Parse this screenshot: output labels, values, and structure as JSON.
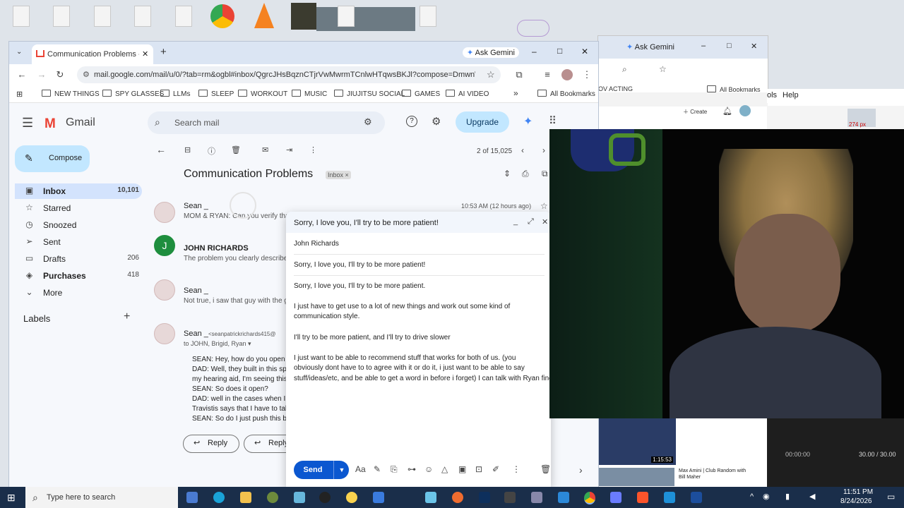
{
  "browser": {
    "tab_title": "Communication Problems - sea",
    "new_tab": "+",
    "ask_gemini": "Ask Gemini",
    "url": "mail.google.com/mail/u/0/?tab=rm&ogbl#inbox/QgrcJHsBqznCTjrVwMwrmTCnlwHTqwsBKJl?compose=DmwnWstp...",
    "minimize": "–",
    "maximize": "□",
    "close": "✕"
  },
  "bookmarks": [
    "NEW THINGS",
    "SPY GLASSES",
    "LLMs",
    "SLEEP",
    "WORKOUT",
    "MUSIC",
    "JIUJITSU SOCIAL",
    "GAMES",
    "AI VIDEO"
  ],
  "bookmarks_more": "»",
  "all_bookmarks": "All Bookmarks",
  "second_window": {
    "ask_gemini": "Ask Gemini",
    "bookmark_partial": "OV ACTING",
    "all_bookmarks": "All Bookmarks",
    "help_menu": "Help",
    "menu_partial": "ols",
    "create": "Create",
    "video_title": "Max Amini | Club Random with Bill Maher",
    "video_duration": "1:15:53",
    "timecode": "00:00:00",
    "fps": "30.00 / 30.00",
    "res_label": "274 px"
  },
  "gmail": {
    "logo": "Gmail",
    "search_placeholder": "Search mail",
    "upgrade": "Upgrade",
    "compose": "Compose",
    "nav": [
      {
        "label": "Inbox",
        "count": "10,101"
      },
      {
        "label": "Starred",
        "count": ""
      },
      {
        "label": "Snoozed",
        "count": ""
      },
      {
        "label": "Sent",
        "count": ""
      },
      {
        "label": "Drafts",
        "count": "206"
      },
      {
        "label": "Purchases",
        "count": "418"
      },
      {
        "label": "More",
        "count": ""
      }
    ],
    "labels_heading": "Labels",
    "pagination": "2 of 15,025",
    "subject": "Communication Problems",
    "inbox_chip": "Inbox ×",
    "messages": [
      {
        "sender": "Sean _",
        "snippet": "MOM & RYAN: Can you verify tha",
        "time": "10:53 AM (12 hours ago)"
      },
      {
        "sender": "JOHN RICHARDS",
        "snippet": "The problem you clearly describe,",
        "avatar_letter": "J"
      },
      {
        "sender": "Sean _",
        "snippet": "Not true, i saw that guy with the gr"
      },
      {
        "sender": "Sean _",
        "sender_email": "<seanpatrickrichards415@",
        "to": "to JOHN, Brigid, Ryan ▾",
        "body": [
          "SEAN: Hey, how do you open this",
          "DAD: Well, they built in this special",
          "my hearing aid, I'm seeing this thin",
          "SEAN: So does it open?",
          "DAD: well in the cases when I hav",
          "Travistis says that I have to talk to",
          "SEAN: So do I just push this butto"
        ]
      }
    ],
    "reply": "Reply",
    "reply_all": "Reply"
  },
  "compose": {
    "header": "Sorry, I love you, I'll try to be more patient!",
    "to": "John Richards",
    "subject": "Sorry, I love you, I'll try to be more patient!",
    "body": [
      "Sorry, I love you, I'll try to be more patient.",
      "I just have to get use to a lot of new things and work out some kind of",
      "communication style.",
      "I'll try to be more patient, and I'll try to drive slower",
      "I just want to be able to recommend stuff that works for both of us. (you",
      "obviously dont have to to agree with it or do it, i just want to be able to say",
      "stuff/ideas/etc, and be able to get a word in before i forget) I can talk with Ryan fine"
    ],
    "send": "Send"
  },
  "taskbar": {
    "search_placeholder": "Type here to search",
    "time": "11:51 PM",
    "date": "8/24/2026"
  },
  "colors": {
    "gmail_red": "#ea4335",
    "selected": "#d3e3fd",
    "compose_btn": "#c2e7ff",
    "send": "#0b57d0",
    "upgrade": "#c2e7ff"
  }
}
